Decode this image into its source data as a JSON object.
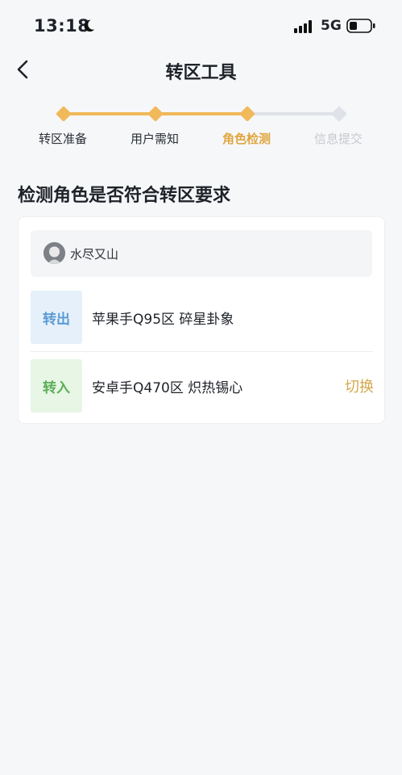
{
  "status_bar": {
    "time": "13:18",
    "network": "5G"
  },
  "nav": {
    "title": "转区工具"
  },
  "steps": [
    {
      "label": "转区准备",
      "state": "done"
    },
    {
      "label": "用户需知",
      "state": "done"
    },
    {
      "label": "角色检测",
      "state": "current"
    },
    {
      "label": "信息提交",
      "state": "pending"
    }
  ],
  "section_title": "检测角色是否符合转区要求",
  "user": {
    "name": "水尽又山"
  },
  "transfer_out": {
    "tag": "转出",
    "server": "苹果手Q95区 碎星卦象"
  },
  "transfer_in": {
    "tag": "转入",
    "server": "安卓手Q470区 炽热锡心",
    "switch_label": "切换"
  },
  "colors": {
    "accent": "#f0b95a",
    "accent_text": "#e0a63f",
    "pending": "#dfe2e8",
    "out_bg": "#e6f0fa",
    "out_text": "#5b9bd5",
    "in_bg": "#e7f6e5",
    "in_text": "#5cae56"
  }
}
